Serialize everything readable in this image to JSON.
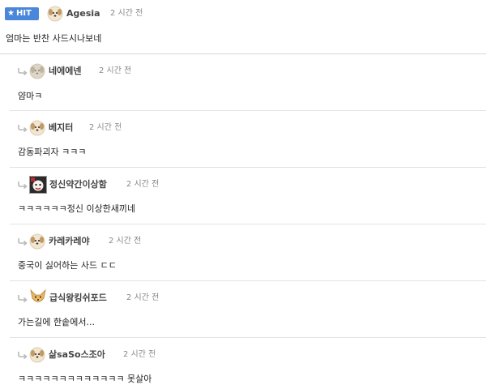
{
  "root": {
    "badge": "HIT",
    "nick": "Agesia",
    "time": "2 시간 전",
    "text": "엄마는 반찬 사드시나보네"
  },
  "replies": [
    {
      "nick": "네에에넨",
      "time": "2 시간 전",
      "text": "얌마ㅋ",
      "avatar": "puppy-avatar-gray-icon"
    },
    {
      "nick": "베지터",
      "time": "2 시간 전",
      "text": "감동파괴자 ㅋㅋㅋ",
      "avatar": "puppy-avatar-icon"
    },
    {
      "nick": "정신약간이상함",
      "time": "2 시간 전",
      "text": "ㅋㅋㅋㅋㅋㅋ정신 이상한새끼네",
      "avatar": "custom-avatar-icon"
    },
    {
      "nick": "카레카레야",
      "time": "2 시간 전",
      "text": "중국이 싫어하는 사드 ㄷㄷ",
      "avatar": "puppy-avatar-icon"
    },
    {
      "nick": "급식왕킹쉬포드",
      "time": "2 시간 전",
      "text": "가는길에 한솥에서...",
      "avatar": "fox-avatar-icon"
    },
    {
      "nick": "삶saSo스조아",
      "time": "2 시간 전",
      "text": "ㅋㅋㅋㅋㅋㅋㅋㅋㅋㅋㅋㅋㅋ 못살아",
      "avatar": "puppy-avatar-icon"
    }
  ],
  "colors": {
    "badge": "#4a86d9",
    "time": "#888888",
    "divider": "#e3e3e3"
  }
}
